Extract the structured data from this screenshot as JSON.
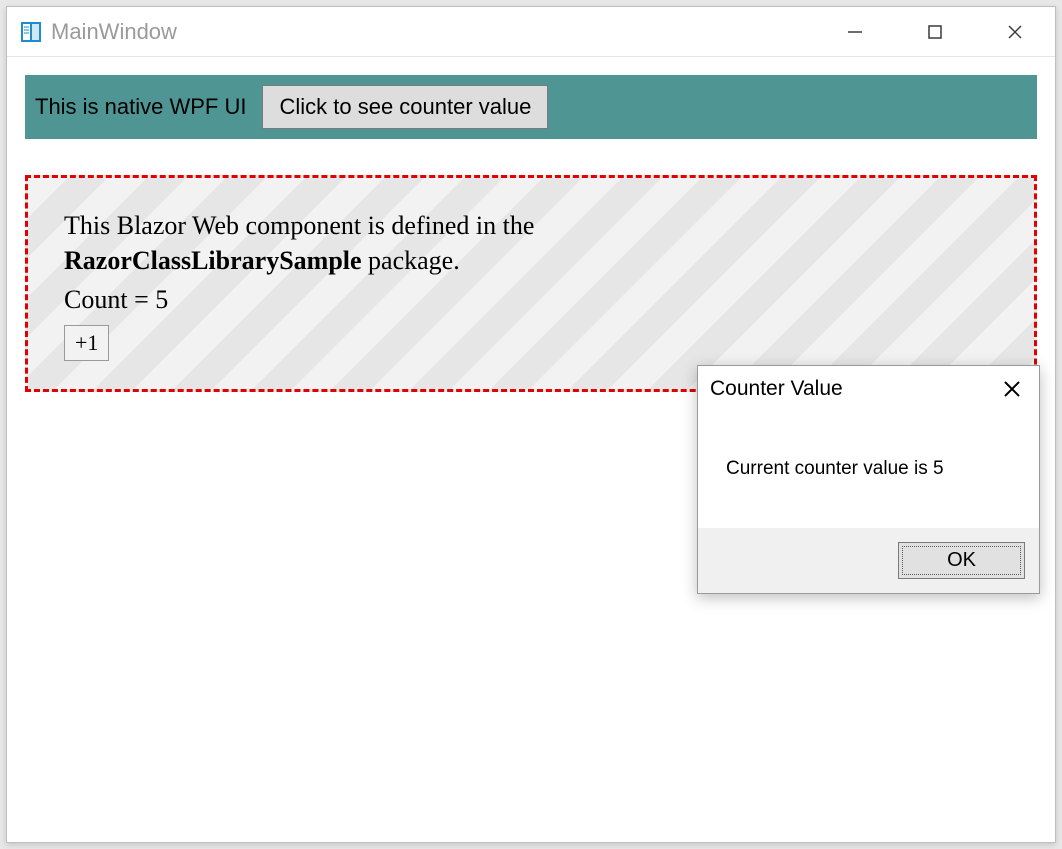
{
  "window": {
    "title": "MainWindow"
  },
  "native_bar": {
    "label": "This is native WPF UI",
    "button_label": "Click to see counter value"
  },
  "blazor": {
    "line1_prefix": "This Blazor Web component is defined in the ",
    "bold_text": "RazorClassLibrarySample",
    "line1_suffix": " package.",
    "count_label": "Count = ",
    "count_value": 5,
    "increment_label": "+1"
  },
  "dialog": {
    "title": "Counter Value",
    "body_prefix": "Current counter value is ",
    "body_value": 5,
    "ok_label": "OK"
  }
}
